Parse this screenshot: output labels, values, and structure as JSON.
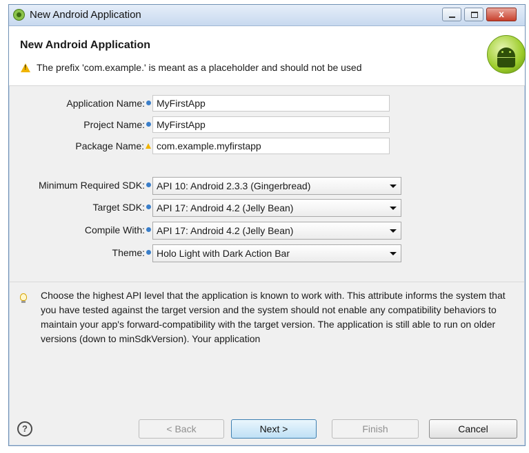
{
  "window": {
    "title": "New Android Application",
    "minimize_glyph": "",
    "maximize_glyph": "",
    "close_glyph": "x"
  },
  "header": {
    "title": "New Android Application",
    "warning": "The prefix 'com.example.' is meant as a placeholder and should not be used"
  },
  "form": {
    "application_name": {
      "label": "Application Name:",
      "value": "MyFirstApp"
    },
    "project_name": {
      "label": "Project Name:",
      "value": "MyFirstApp"
    },
    "package_name": {
      "label": "Package Name:",
      "value": "com.example.myfirstapp"
    },
    "min_sdk": {
      "label": "Minimum Required SDK:",
      "value": "API 10: Android 2.3.3 (Gingerbread)"
    },
    "target_sdk": {
      "label": "Target SDK:",
      "value": "API 17: Android 4.2 (Jelly Bean)"
    },
    "compile_with": {
      "label": "Compile With:",
      "value": "API 17: Android 4.2 (Jelly Bean)"
    },
    "theme": {
      "label": "Theme:",
      "value": "Holo Light with Dark Action Bar"
    }
  },
  "help": {
    "text": "Choose the highest API level that the application is known to work with. This attribute informs the system that you have tested against the target version and the system should not enable any compatibility behaviors to maintain your app's forward-compatibility with the target version. The application is still able to run on older versions (down to minSdkVersion). Your application"
  },
  "buttons": {
    "help": "?",
    "back": "< Back",
    "next": "Next >",
    "finish": "Finish",
    "cancel": "Cancel"
  },
  "icons": {
    "app": "android-app-icon",
    "warning": "warning-icon",
    "info": "info-icon",
    "bulb": "lightbulb-icon",
    "logo": "android-logo"
  },
  "colors": {
    "title_bar": "#c8d9ef",
    "close_button": "#c7402c",
    "android_green": "#9ccc2a",
    "info_blue": "#3a7ec9",
    "warning_yellow": "#f0b400"
  }
}
